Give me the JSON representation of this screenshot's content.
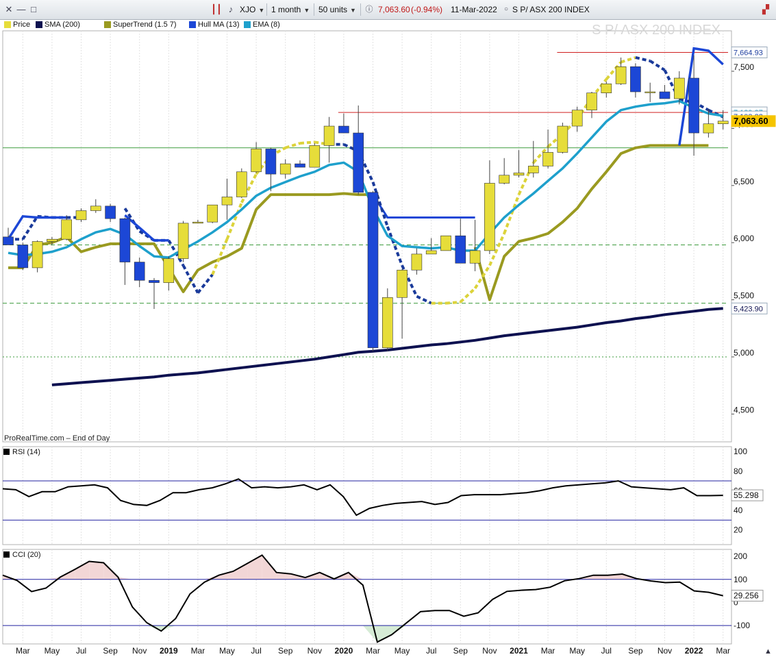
{
  "toolbar": {
    "symbol": "XJO",
    "period": "1 month",
    "units": "50 units",
    "last_value": "7,063.60",
    "change": "(-0.94%)",
    "date": "11-Mar-2022",
    "instrument": "S P/ ASX 200 INDEX"
  },
  "legend": [
    {
      "label": "Price",
      "color": "#e6dd3a"
    },
    {
      "label": "SMA (200)",
      "color": "#0d1150"
    },
    {
      "label": "SuperTrend (1.5 7)",
      "color": "#9a9a20"
    },
    {
      "label": "Hull MA (13)",
      "color": "#1c47d6"
    },
    {
      "label": "EMA (8)",
      "color": "#1ea0cc"
    }
  ],
  "colors": {
    "up_candle": "#e6dd3a",
    "down_candle": "#1c47d6",
    "sma": "#0d1150",
    "supertrend": "#9a9a20",
    "hull": "#1c47d6",
    "ema": "#1ea0cc",
    "resistance": "#d02020",
    "support": "#3d9b3d",
    "rsi_line": "#000000",
    "band_line": "#2020a0"
  },
  "watermark": "S P/ ASX 200 INDEX",
  "footer_label": "ProRealTime.com – End of Day",
  "chart_data": [
    {
      "type": "candlestick",
      "name": "Price",
      "ylim": [
        4300,
        7800
      ],
      "y_ticks": [
        4500,
        5000,
        5500,
        6000,
        6500,
        7000,
        7500
      ],
      "y_tick_labels": [
        "4,500",
        "5,000",
        "5,500",
        "6,000",
        "6,500",
        "7,000",
        "7,500"
      ],
      "x": [
        "Feb 2018",
        "Mar 2018",
        "Apr 2018",
        "May 2018",
        "Jun 2018",
        "Jul 2018",
        "Aug 2018",
        "Sep 2018",
        "Oct 2018",
        "Nov 2018",
        "Dec 2018",
        "Jan 2019",
        "Feb 2019",
        "Mar 2019",
        "Apr 2019",
        "May 2019",
        "Jun 2019",
        "Jul 2019",
        "Aug 2019",
        "Sep 2019",
        "Oct 2019",
        "Nov 2019",
        "Dec 2019",
        "Jan 2020",
        "Feb 2020",
        "Mar 2020",
        "Apr 2020",
        "May 2020",
        "Jun 2020",
        "Jul 2020",
        "Aug 2020",
        "Sep 2020",
        "Oct 2020",
        "Nov 2020",
        "Dec 2020",
        "Jan 2021",
        "Feb 2021",
        "Mar 2021",
        "Apr 2021",
        "May 2021",
        "Jun 2021",
        "Jul 2021",
        "Aug 2021",
        "Sep 2021",
        "Oct 2021",
        "Nov 2021",
        "Dec 2021",
        "Jan 2022",
        "Feb 2022",
        "Mar 2022"
      ],
      "x_tick_labels": [
        {
          "month": "Mar 2018",
          "label": "Mar"
        },
        {
          "month": "May 2018",
          "label": "May"
        },
        {
          "month": "Jul 2018",
          "label": "Jul"
        },
        {
          "month": "Sep 2018",
          "label": "Sep"
        },
        {
          "month": "Nov 2018",
          "label": "Nov"
        },
        {
          "month": "Jan 2019",
          "label": "2019",
          "bold": true
        },
        {
          "month": "Mar 2019",
          "label": "Mar"
        },
        {
          "month": "May 2019",
          "label": "May"
        },
        {
          "month": "Jul 2019",
          "label": "Jul"
        },
        {
          "month": "Sep 2019",
          "label": "Sep"
        },
        {
          "month": "Nov 2019",
          "label": "Nov"
        },
        {
          "month": "Jan 2020",
          "label": "2020",
          "bold": true
        },
        {
          "month": "Mar 2020",
          "label": "Mar"
        },
        {
          "month": "May 2020",
          "label": "May"
        },
        {
          "month": "Jul 2020",
          "label": "Jul"
        },
        {
          "month": "Sep 2020",
          "label": "Sep"
        },
        {
          "month": "Nov 2020",
          "label": "Nov"
        },
        {
          "month": "Jan 2021",
          "label": "2021",
          "bold": true
        },
        {
          "month": "Mar 2021",
          "label": "Mar"
        },
        {
          "month": "May 2021",
          "label": "May"
        },
        {
          "month": "Jul 2021",
          "label": "Jul"
        },
        {
          "month": "Sep 2021",
          "label": "Sep"
        },
        {
          "month": "Nov 2021",
          "label": "Nov"
        },
        {
          "month": "Jan 2022",
          "label": "2022",
          "bold": true
        },
        {
          "month": "Mar 2022",
          "label": "Mar"
        }
      ],
      "ohlc": [
        [
          6050,
          6130,
          5990,
          5980
        ],
        [
          5980,
          6000,
          5760,
          5780
        ],
        [
          5780,
          6020,
          5740,
          6010
        ],
        [
          6010,
          6050,
          5980,
          6030
        ],
        [
          6030,
          6240,
          6020,
          6200
        ],
        [
          6200,
          6300,
          6180,
          6280
        ],
        [
          6280,
          6380,
          6260,
          6320
        ],
        [
          6320,
          6340,
          6180,
          6210
        ],
        [
          6210,
          6220,
          5630,
          5830
        ],
        [
          5830,
          5870,
          5610,
          5670
        ],
        [
          5670,
          5690,
          5420,
          5650
        ],
        [
          5650,
          5880,
          5580,
          5860
        ],
        [
          5860,
          6190,
          5830,
          6170
        ],
        [
          6170,
          6200,
          6170,
          6180
        ],
        [
          6180,
          6330,
          6170,
          6330
        ],
        [
          6330,
          6560,
          6200,
          6400
        ],
        [
          6400,
          6650,
          6390,
          6620
        ],
        [
          6620,
          6880,
          6610,
          6820
        ],
        [
          6820,
          6830,
          6450,
          6600
        ],
        [
          6600,
          6730,
          6560,
          6690
        ],
        [
          6690,
          6720,
          6660,
          6660
        ],
        [
          6660,
          6870,
          6660,
          6850
        ],
        [
          6850,
          7100,
          6700,
          7020
        ],
        [
          7020,
          7130,
          6980,
          6960
        ],
        [
          6960,
          7200,
          6420,
          6440
        ],
        [
          6440,
          6450,
          5050,
          5080
        ],
        [
          5080,
          5600,
          5050,
          5520
        ],
        [
          5520,
          5770,
          5160,
          5760
        ],
        [
          5760,
          5950,
          5720,
          5900
        ],
        [
          5900,
          6040,
          5910,
          5930
        ],
        [
          5930,
          6040,
          5960,
          6060
        ],
        [
          6060,
          6210,
          5850,
          5820
        ],
        [
          5820,
          6200,
          5750,
          5930
        ],
        [
          5930,
          6720,
          5900,
          6520
        ],
        [
          6520,
          6740,
          6510,
          6590
        ],
        [
          6590,
          6810,
          6570,
          6610
        ],
        [
          6610,
          6890,
          6570,
          6670
        ],
        [
          6670,
          6990,
          6650,
          6790
        ],
        [
          6790,
          7050,
          6780,
          7020
        ],
        [
          7020,
          7190,
          6970,
          7160
        ],
        [
          7160,
          7320,
          7090,
          7310
        ],
        [
          7310,
          7410,
          7270,
          7390
        ],
        [
          7390,
          7620,
          7380,
          7540
        ],
        [
          7540,
          7570,
          7270,
          7320
        ],
        [
          7320,
          7400,
          7230,
          7320
        ],
        [
          7320,
          7380,
          7260,
          7260
        ],
        [
          7260,
          7500,
          7210,
          7440
        ],
        [
          7440,
          7640,
          6760,
          6960
        ],
        [
          6960,
          7170,
          6920,
          7040
        ],
        [
          7040,
          7160,
          6990,
          7063.6
        ]
      ],
      "sma200": [
        4720,
        4730,
        4745,
        4755,
        4765,
        4775,
        4785,
        4795,
        4805,
        4815,
        4825,
        4840,
        4850,
        4860,
        4875,
        4890,
        4905,
        4920,
        4935,
        4950,
        4965,
        4980,
        5000,
        5020,
        5040,
        5050,
        5060,
        5075,
        5090,
        5105,
        5115,
        5130,
        5145,
        5165,
        5185,
        5200,
        5215,
        5230,
        5245,
        5260,
        5280,
        5300,
        5315,
        5335,
        5350,
        5370,
        5385,
        5400,
        5415,
        5423.9
      ],
      "supertrend": [
        5780,
        5780,
        5980,
        6000,
        6050,
        5920,
        5960,
        5990,
        5990,
        5990,
        5990,
        5780,
        5570,
        5760,
        5830,
        5880,
        5950,
        6290,
        6420,
        6420,
        6420,
        6420,
        6420,
        6430,
        6420,
        6420,
        null,
        null,
        null,
        null,
        null,
        null,
        5960,
        5500,
        5880,
        6010,
        6040,
        6080,
        6180,
        6300,
        6470,
        6620,
        6780,
        6830,
        6850,
        6850,
        6850,
        6850,
        6850,
        null
      ],
      "hull": [
        6030,
        6030,
        6230,
        6220,
        6220,
        6220,
        null,
        null,
        6300,
        6100,
        6020,
        6020,
        5800,
        5560,
        5720,
        6030,
        6350,
        6600,
        6760,
        6830,
        6870,
        6880,
        6860,
        6860,
        6800,
        6530,
        6140,
        5800,
        5530,
        5470,
        5470,
        5480,
        5600,
        5800,
        6080,
        6420,
        6700,
        6840,
        6950,
        7080,
        7270,
        7430,
        7580,
        7620,
        7590,
        7510,
        7250,
        7230,
        7160,
        7100
      ],
      "hull_up": [
        false,
        false,
        false,
        false,
        false,
        false,
        false,
        false,
        false,
        false,
        false,
        false,
        false,
        false,
        true,
        true,
        true,
        true,
        true,
        true,
        true,
        true,
        false,
        false,
        false,
        false,
        false,
        false,
        false,
        true,
        true,
        true,
        true,
        true,
        true,
        true,
        true,
        true,
        true,
        true,
        true,
        true,
        true,
        false,
        false,
        false,
        false,
        false,
        false,
        false
      ],
      "hull_solid_left": [
        6030,
        6230,
        6220,
        6220,
        6220
      ],
      "hull_solid_mid": [
        6240,
        6130,
        6020,
        6020
      ],
      "hull_solid_right": [
        7700,
        7680,
        7620,
        7560
      ],
      "ema8": [
        5910,
        5890,
        5900,
        5920,
        5960,
        6030,
        6090,
        6120,
        6070,
        5970,
        5880,
        5870,
        5940,
        6010,
        6090,
        6180,
        6290,
        6410,
        6480,
        6530,
        6580,
        6620,
        6680,
        6700,
        6620,
        6300,
        6060,
        5970,
        5960,
        5950,
        5960,
        5930,
        5930,
        6080,
        6220,
        6330,
        6430,
        6540,
        6650,
        6780,
        6920,
        7060,
        7160,
        7190,
        7210,
        7220,
        7240,
        7180,
        7130,
        7110
      ],
      "h_lines": [
        {
          "value": 7664.93,
          "color": "#d02020",
          "style": "solid",
          "from": 38
        },
        {
          "value": 7139.37,
          "color": "#d02020",
          "style": "solid",
          "from": 23
        },
        {
          "value": 6830,
          "color": "#3d9b3d",
          "style": "solid",
          "from": 0
        },
        {
          "value": 5980,
          "color": "#3d9b3d",
          "style": "dashed",
          "from": 0
        },
        {
          "value": 5470,
          "color": "#3d9b3d",
          "style": "dashed",
          "from": 0
        },
        {
          "value": 5000,
          "color": "#3d9b3d",
          "style": "dotted",
          "from": 0
        }
      ],
      "right_labels": [
        {
          "value": 7664.93,
          "text": "7,664.93",
          "color": "#2040a0"
        },
        {
          "value": 7139.37,
          "text": "7,139.37",
          "color": "#1ea0cc"
        },
        {
          "value": 7103.22,
          "text": "7,103.22",
          "color": "#2040a0"
        },
        {
          "value": 7063.6,
          "text": "7,063.60",
          "color": "#000000",
          "highlight": true
        },
        {
          "value": 5423.9,
          "text": "5,423.90",
          "color": "#0d1150"
        }
      ]
    },
    {
      "type": "line",
      "name": "RSI (14)",
      "ylim": [
        5,
        105
      ],
      "y_ticks": [
        20,
        40,
        60,
        80,
        100
      ],
      "bands": [
        70,
        30
      ],
      "values": [
        62,
        61,
        54,
        59,
        59,
        64,
        65,
        66,
        63,
        50,
        46,
        45,
        50,
        58,
        58,
        61,
        63,
        67,
        72,
        63,
        64,
        63,
        64,
        66,
        61,
        66,
        54,
        35,
        42,
        45,
        47,
        48,
        49,
        46,
        48,
        55,
        56,
        56,
        56,
        57,
        58,
        60,
        63,
        65,
        66,
        67,
        68,
        70,
        64,
        63,
        62,
        61,
        63,
        55,
        55,
        55.298
      ],
      "last_label": "55.298"
    },
    {
      "type": "line",
      "name": "CCI (20)",
      "ylim": [
        -180,
        230
      ],
      "y_ticks": [
        200,
        100,
        0,
        -100
      ],
      "y_tick_labels": [
        "200",
        "100",
        "0",
        "-100"
      ],
      "bands": [
        100,
        -100
      ],
      "values": [
        118,
        95,
        47,
        62,
        110,
        143,
        178,
        172,
        110,
        -20,
        -88,
        -124,
        -70,
        37,
        88,
        118,
        135,
        170,
        205,
        130,
        124,
        108,
        130,
        102,
        130,
        75,
        -172,
        -140,
        -90,
        -40,
        -35,
        -35,
        -60,
        -45,
        13,
        48,
        53,
        56,
        66,
        94,
        103,
        118,
        118,
        123,
        103,
        93,
        86,
        88,
        50,
        44,
        29.256
      ],
      "last_label": "29.256"
    }
  ]
}
